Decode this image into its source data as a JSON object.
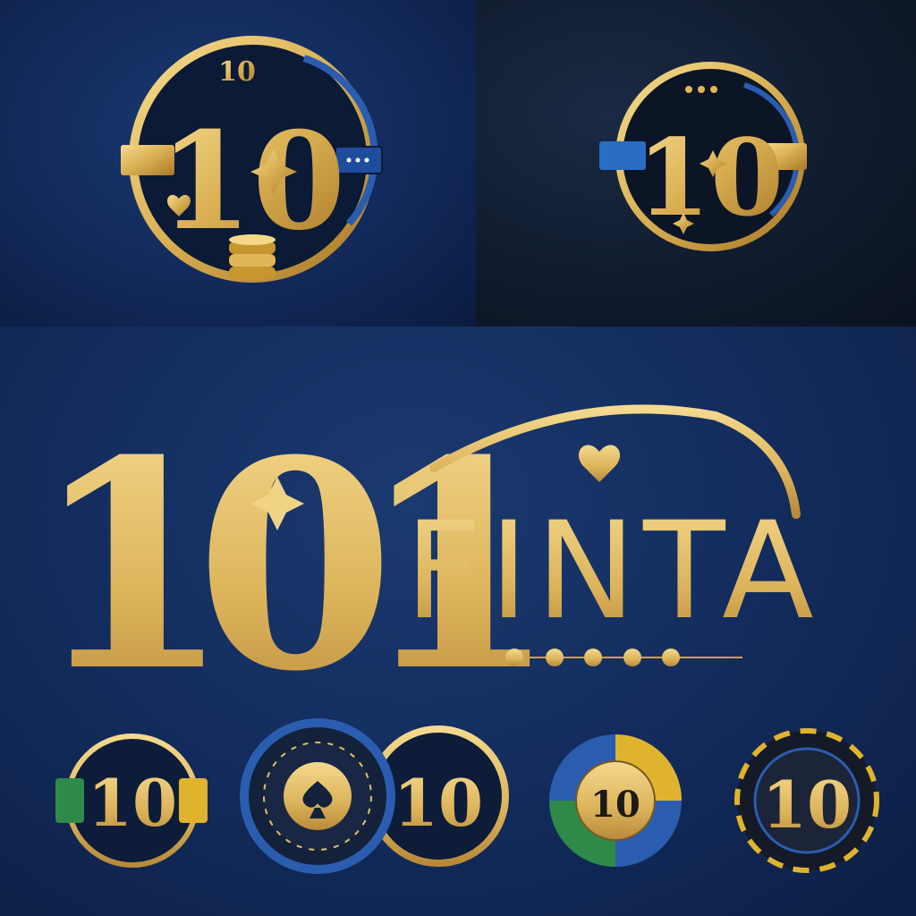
{
  "colors": {
    "gold": "#e7c36a",
    "gold_dark": "#b88a30",
    "navy": "#0f2548",
    "chip_blue": "#2a5db0",
    "chip_green": "#2f8a4a",
    "chip_yellow": "#e0b32e"
  },
  "emblems": {
    "top_left_number": "10",
    "top_left_small_number": "10",
    "top_right_number": "10"
  },
  "wordmark": {
    "monogram": "101",
    "name": "FINTA"
  },
  "chips": [
    {
      "label": "10"
    },
    {
      "label": "10"
    },
    {
      "label": "10"
    },
    {
      "label": "10"
    }
  ],
  "icons": [
    "heart-icon",
    "sparkle-icon",
    "spade-icon",
    "coin-stack-icon",
    "dot-divider-icon"
  ]
}
